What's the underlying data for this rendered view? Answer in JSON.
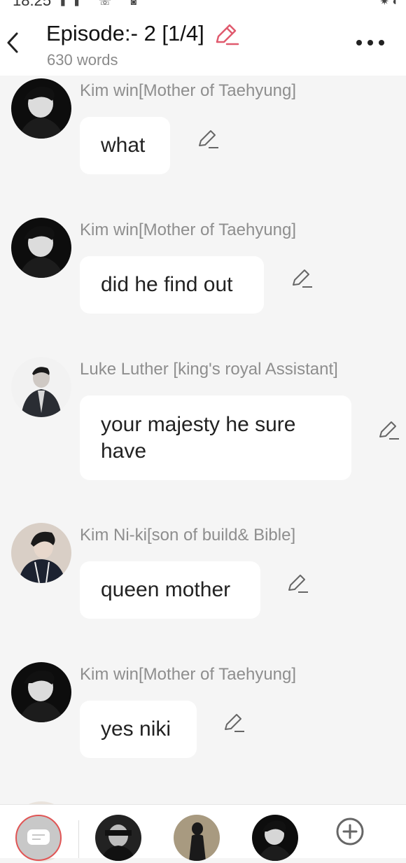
{
  "status_bar": {
    "time": "18:25"
  },
  "header": {
    "title": "Episode:- 2 [1/4]",
    "word_count": "630 words"
  },
  "messages": [
    {
      "sender": "Kim win[Mother of Taehyung]",
      "text": "what",
      "avatar": "dark-portrait"
    },
    {
      "sender": "Kim win[Mother of Taehyung]",
      "text": "did he find out",
      "avatar": "dark-portrait"
    },
    {
      "sender": "Luke Luther [king's royal Assistant]",
      "text": "your majesty he sure have",
      "avatar": "suited-figure"
    },
    {
      "sender": "Kim Ni-ki[son of build& Bible]",
      "text": "queen mother",
      "avatar": "hooded-young-man"
    },
    {
      "sender": "Kim win[Mother of Taehyung]",
      "text": "yes niki",
      "avatar": "dark-portrait"
    }
  ],
  "bottom_bar": {
    "icons": [
      "chat-bubble-icon",
      "character-1-avatar",
      "character-2-avatar",
      "character-3-avatar",
      "add-character-icon"
    ]
  },
  "colors": {
    "accent": "#e05a6e",
    "sender_text": "#8e8e8e",
    "background": "#f5f5f5"
  }
}
